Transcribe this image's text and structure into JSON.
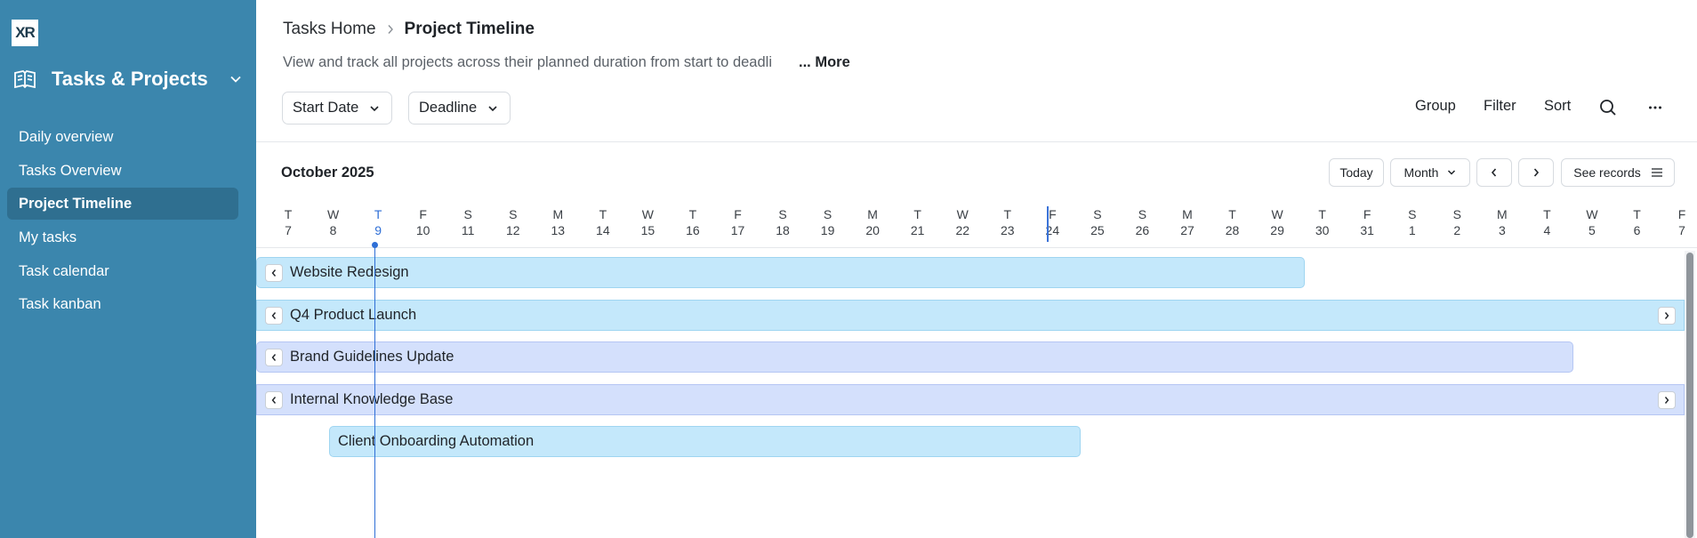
{
  "app": {
    "logo_text": "XR",
    "workspace_name": "Tasks & Projects"
  },
  "sidebar": {
    "items": [
      {
        "label": "Daily overview",
        "active": false
      },
      {
        "label": "Tasks Overview",
        "active": false
      },
      {
        "label": "Project Timeline",
        "active": true
      },
      {
        "label": "My tasks",
        "active": false
      },
      {
        "label": "Task calendar",
        "active": false
      },
      {
        "label": "Task kanban",
        "active": false
      }
    ]
  },
  "header": {
    "breadcrumb_home": "Tasks Home",
    "breadcrumb_current": "Project Timeline",
    "description": "View and track all projects across their planned duration from start to deadli",
    "more_label": "... More"
  },
  "toolbar": {
    "start_field": "Start Date",
    "end_field": "Deadline",
    "group_label": "Group",
    "filter_label": "Filter",
    "sort_label": "Sort"
  },
  "timeline": {
    "month_label": "October 2025",
    "today_label": "Today",
    "scale_label": "Month",
    "see_records_label": "See records",
    "today_index": 2,
    "days": [
      {
        "dow": "T",
        "num": "7"
      },
      {
        "dow": "W",
        "num": "8"
      },
      {
        "dow": "T",
        "num": "9"
      },
      {
        "dow": "F",
        "num": "10"
      },
      {
        "dow": "S",
        "num": "11"
      },
      {
        "dow": "S",
        "num": "12"
      },
      {
        "dow": "M",
        "num": "13"
      },
      {
        "dow": "T",
        "num": "14"
      },
      {
        "dow": "W",
        "num": "15"
      },
      {
        "dow": "T",
        "num": "16"
      },
      {
        "dow": "F",
        "num": "17"
      },
      {
        "dow": "S",
        "num": "18"
      },
      {
        "dow": "S",
        "num": "19"
      },
      {
        "dow": "M",
        "num": "20"
      },
      {
        "dow": "T",
        "num": "21"
      },
      {
        "dow": "W",
        "num": "22"
      },
      {
        "dow": "T",
        "num": "23"
      },
      {
        "dow": "F",
        "num": "24"
      },
      {
        "dow": "S",
        "num": "25"
      },
      {
        "dow": "S",
        "num": "26"
      },
      {
        "dow": "M",
        "num": "27"
      },
      {
        "dow": "T",
        "num": "28"
      },
      {
        "dow": "W",
        "num": "29"
      },
      {
        "dow": "T",
        "num": "30"
      },
      {
        "dow": "F",
        "num": "31"
      },
      {
        "dow": "S",
        "num": "1"
      },
      {
        "dow": "S",
        "num": "2"
      },
      {
        "dow": "M",
        "num": "3"
      },
      {
        "dow": "T",
        "num": "4"
      },
      {
        "dow": "W",
        "num": "5"
      },
      {
        "dow": "T",
        "num": "6"
      },
      {
        "dow": "F",
        "num": "7"
      }
    ],
    "projects": [
      {
        "name": "Website Redesign",
        "color": "#c4e8fb",
        "continues_left": true,
        "continues_right": false
      },
      {
        "name": "Q4 Product Launch",
        "color": "#c4e8fb",
        "continues_left": true,
        "continues_right": true
      },
      {
        "name": "Brand Guidelines Update",
        "color": "#d4e0fc",
        "continues_left": true,
        "continues_right": false
      },
      {
        "name": "Internal Knowledge Base",
        "color": "#d4e0fc",
        "continues_left": true,
        "continues_right": true
      },
      {
        "name": "Client Onboarding Automation",
        "color": "#c4e8fb",
        "continues_left": false,
        "continues_right": false
      }
    ]
  },
  "colors": {
    "sidebar_bg": "#3b86ad",
    "sidebar_active": "#2f6f90",
    "today_accent": "#2f6fd6",
    "bar_cyan": "#c4e8fb",
    "bar_lavender": "#d4e0fc"
  }
}
